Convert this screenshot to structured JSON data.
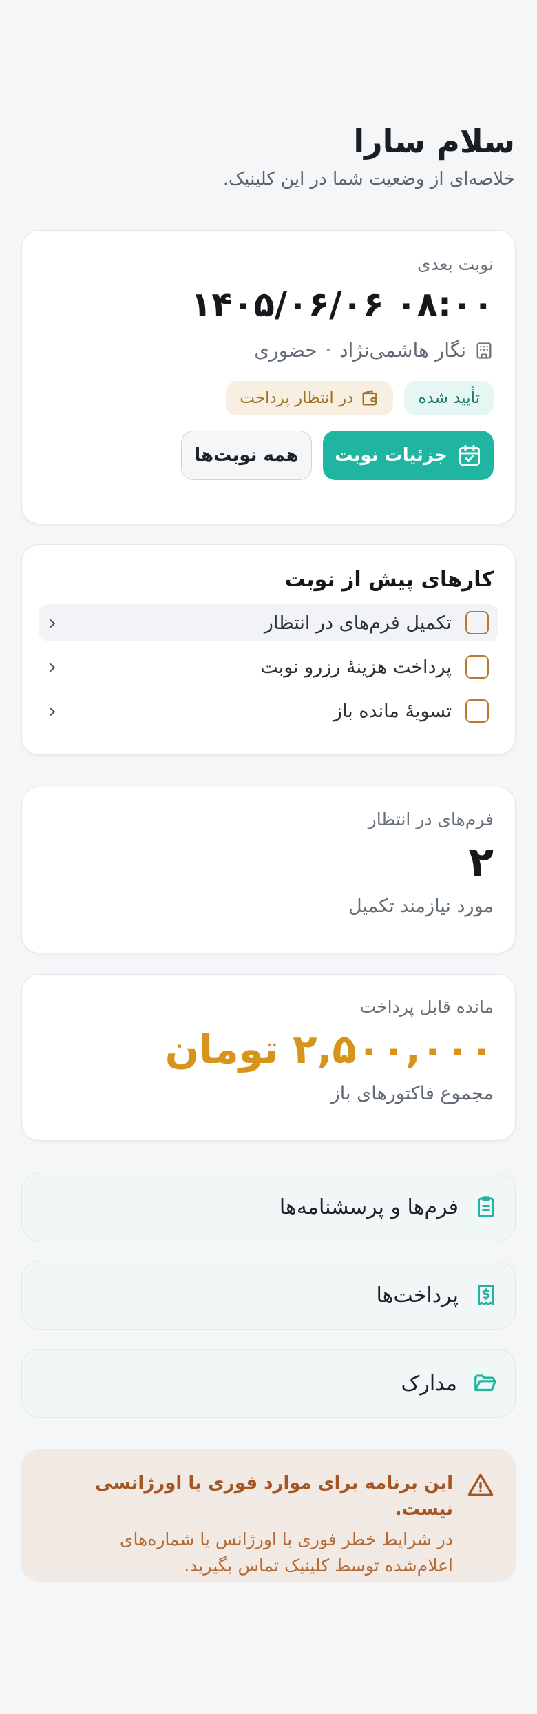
{
  "greeting": {
    "title": "سلام سارا",
    "subtitle": "خلاصه‌ای از وضعیت شما در این کلینیک."
  },
  "next_appointment": {
    "label": "نوبت بعدی",
    "datetime": "۰۸:۰۰ ۱۴۰۵/۰۶/۰۶",
    "doctor": "نگار هاشمی‌نژاد",
    "visit_type": "حضوری",
    "doctor_icon": "building-icon",
    "badges": {
      "confirmed": "تأیید شده",
      "payment_pending": "در انتظار پرداخت"
    },
    "details_button": "جزئیات نوبت",
    "all_button": "همه نوبت‌ها"
  },
  "tasks": {
    "title": "کارهای پیش از نوبت",
    "items": [
      {
        "label": "تکمیل فرم‌های در انتظار"
      },
      {
        "label": "پرداخت هزینهٔ رزرو نوبت"
      },
      {
        "label": "تسویهٔ مانده باز"
      }
    ]
  },
  "forms_stat": {
    "label": "فرم‌های در انتظار",
    "value": "۲",
    "caption": "مورد نیازمند تکمیل"
  },
  "balance_stat": {
    "label": "مانده قابل پرداخت",
    "value": "۲,۵۰۰,۰۰۰ تومان",
    "caption": "مجموع فاکتورهای باز"
  },
  "nav_cards": {
    "forms": "فرم‌ها و پرسشنامه‌ها",
    "payments": "پرداخت‌ها",
    "documents": "مدارک"
  },
  "warning": {
    "title": "این برنامه برای موارد فوری یا اورژانسی نیست.",
    "body": "در شرایط خطر فوری با اورژانس یا شماره‌های اعلام‌شده توسط کلینیک تماس بگیرید."
  },
  "colors": {
    "accent": "#1fb5a0",
    "money": "#d6951a",
    "warning_bg": "#f1e9e3",
    "warning_text": "#a45622"
  }
}
